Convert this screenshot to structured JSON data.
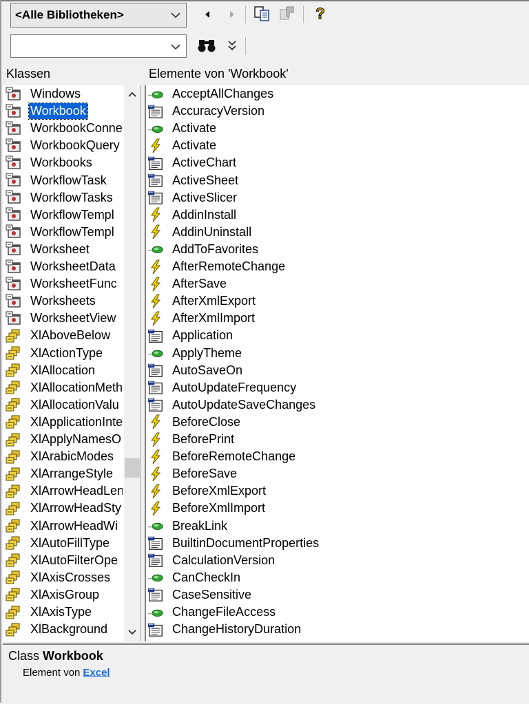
{
  "toolbar": {
    "library_combo": "<Alle Bibliotheken>",
    "search_combo": ""
  },
  "classes": {
    "header": "Klassen",
    "selected": "Workbook",
    "items": [
      {
        "label": "Windows",
        "kind": "class"
      },
      {
        "label": "Workbook",
        "kind": "class"
      },
      {
        "label": "WorkbookConne",
        "kind": "class"
      },
      {
        "label": "WorkbookQuery",
        "kind": "class"
      },
      {
        "label": "Workbooks",
        "kind": "class"
      },
      {
        "label": "WorkflowTask",
        "kind": "class"
      },
      {
        "label": "WorkflowTasks",
        "kind": "class"
      },
      {
        "label": "WorkflowTempl",
        "kind": "class"
      },
      {
        "label": "WorkflowTempl",
        "kind": "class"
      },
      {
        "label": "Worksheet",
        "kind": "class"
      },
      {
        "label": "WorksheetData",
        "kind": "class"
      },
      {
        "label": "WorksheetFunc",
        "kind": "class"
      },
      {
        "label": "Worksheets",
        "kind": "class"
      },
      {
        "label": "WorksheetView",
        "kind": "class"
      },
      {
        "label": "XlAboveBelow",
        "kind": "enum"
      },
      {
        "label": "XlActionType",
        "kind": "enum"
      },
      {
        "label": "XlAllocation",
        "kind": "enum"
      },
      {
        "label": "XlAllocationMeth",
        "kind": "enum"
      },
      {
        "label": "XlAllocationValu",
        "kind": "enum"
      },
      {
        "label": "XlApplicationInte",
        "kind": "enum"
      },
      {
        "label": "XlApplyNamesO",
        "kind": "enum"
      },
      {
        "label": "XlArabicModes",
        "kind": "enum"
      },
      {
        "label": "XlArrangeStyle",
        "kind": "enum"
      },
      {
        "label": "XlArrowHeadLen",
        "kind": "enum"
      },
      {
        "label": "XlArrowHeadSty",
        "kind": "enum"
      },
      {
        "label": "XlArrowHeadWi",
        "kind": "enum"
      },
      {
        "label": "XlAutoFillType",
        "kind": "enum"
      },
      {
        "label": "XlAutoFilterOpe",
        "kind": "enum"
      },
      {
        "label": "XlAxisCrosses",
        "kind": "enum"
      },
      {
        "label": "XlAxisGroup",
        "kind": "enum"
      },
      {
        "label": "XlAxisType",
        "kind": "enum"
      },
      {
        "label": "XlBackground",
        "kind": "enum"
      }
    ]
  },
  "members": {
    "header": "Elemente von 'Workbook'",
    "items": [
      {
        "label": "AcceptAllChanges",
        "kind": "method"
      },
      {
        "label": "AccuracyVersion",
        "kind": "property"
      },
      {
        "label": "Activate",
        "kind": "method"
      },
      {
        "label": "Activate",
        "kind": "event"
      },
      {
        "label": "ActiveChart",
        "kind": "property"
      },
      {
        "label": "ActiveSheet",
        "kind": "property"
      },
      {
        "label": "ActiveSlicer",
        "kind": "property"
      },
      {
        "label": "AddinInstall",
        "kind": "event"
      },
      {
        "label": "AddinUninstall",
        "kind": "event"
      },
      {
        "label": "AddToFavorites",
        "kind": "method"
      },
      {
        "label": "AfterRemoteChange",
        "kind": "event"
      },
      {
        "label": "AfterSave",
        "kind": "event"
      },
      {
        "label": "AfterXmlExport",
        "kind": "event"
      },
      {
        "label": "AfterXmlImport",
        "kind": "event"
      },
      {
        "label": "Application",
        "kind": "property"
      },
      {
        "label": "ApplyTheme",
        "kind": "method"
      },
      {
        "label": "AutoSaveOn",
        "kind": "property"
      },
      {
        "label": "AutoUpdateFrequency",
        "kind": "property"
      },
      {
        "label": "AutoUpdateSaveChanges",
        "kind": "property"
      },
      {
        "label": "BeforeClose",
        "kind": "event"
      },
      {
        "label": "BeforePrint",
        "kind": "event"
      },
      {
        "label": "BeforeRemoteChange",
        "kind": "event"
      },
      {
        "label": "BeforeSave",
        "kind": "event"
      },
      {
        "label": "BeforeXmlExport",
        "kind": "event"
      },
      {
        "label": "BeforeXmlImport",
        "kind": "event"
      },
      {
        "label": "BreakLink",
        "kind": "method"
      },
      {
        "label": "BuiltinDocumentProperties",
        "kind": "property"
      },
      {
        "label": "CalculationVersion",
        "kind": "property"
      },
      {
        "label": "CanCheckIn",
        "kind": "method"
      },
      {
        "label": "CaseSensitive",
        "kind": "property"
      },
      {
        "label": "ChangeFileAccess",
        "kind": "method"
      },
      {
        "label": "ChangeHistoryDuration",
        "kind": "property"
      }
    ]
  },
  "details": {
    "prefix": "Class",
    "name": "Workbook",
    "member_of": "Element von",
    "library": "Excel"
  }
}
